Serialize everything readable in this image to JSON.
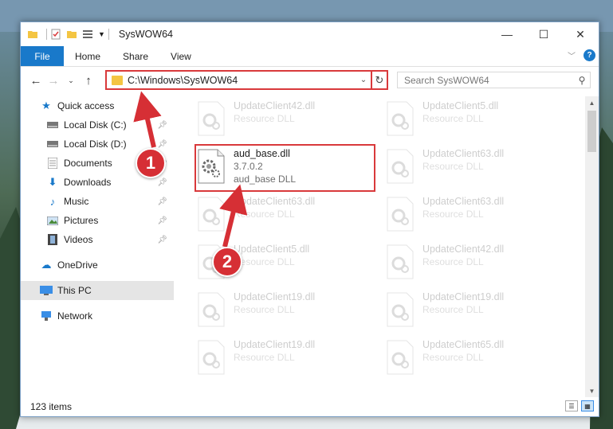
{
  "window": {
    "title": "SysWOW64",
    "minimize_glyph": "—",
    "maximize_glyph": "☐",
    "close_glyph": "✕"
  },
  "ribbon": {
    "tabs": [
      "File",
      "Home",
      "Share",
      "View"
    ]
  },
  "nav": {
    "address": "C:\\Windows\\SysWOW64",
    "search_placeholder": "Search SysWOW64"
  },
  "sidebar": {
    "quick_access": "Quick access",
    "items": [
      "Local Disk (C:)",
      "Local Disk (D:)",
      "Documents",
      "Downloads",
      "Music",
      "Pictures",
      "Videos"
    ],
    "onedrive": "OneDrive",
    "this_pc": "This PC",
    "network": "Network"
  },
  "files": {
    "highlighted": {
      "name": "aud_base.dll",
      "version": "3.7.0.2",
      "description": "aud_base DLL"
    },
    "ghosts": [
      {
        "name": "UpdateClient42.dll",
        "sub": "Resource DLL"
      },
      {
        "name": "UpdateClient5.dll",
        "sub": "Resource DLL"
      },
      {
        "name": "UpdateClient63.dll",
        "sub": "Resource DLL"
      },
      {
        "name": "UpdateClient63.dll",
        "sub": "Resource DLL"
      },
      {
        "name": "UpdateClient63.dll",
        "sub": "Resource DLL"
      },
      {
        "name": "UpdateClient5.dll",
        "sub": "Resource DLL"
      },
      {
        "name": "UpdateClient42.dll",
        "sub": "Resource DLL"
      },
      {
        "name": "UpdateClient19.dll",
        "sub": "Resource DLL"
      },
      {
        "name": "UpdateClient19.dll",
        "sub": "Resource DLL"
      },
      {
        "name": "UpdateClient19.dll",
        "sub": "Resource DLL"
      },
      {
        "name": "UpdateClient65.dll",
        "sub": "Resource DLL"
      }
    ]
  },
  "status": {
    "count": "123 items"
  },
  "annotations": {
    "badge1": "1",
    "badge2": "2"
  },
  "colors": {
    "accent": "#1979ca",
    "highlight": "#d9393b",
    "badge": "#d62f35"
  }
}
